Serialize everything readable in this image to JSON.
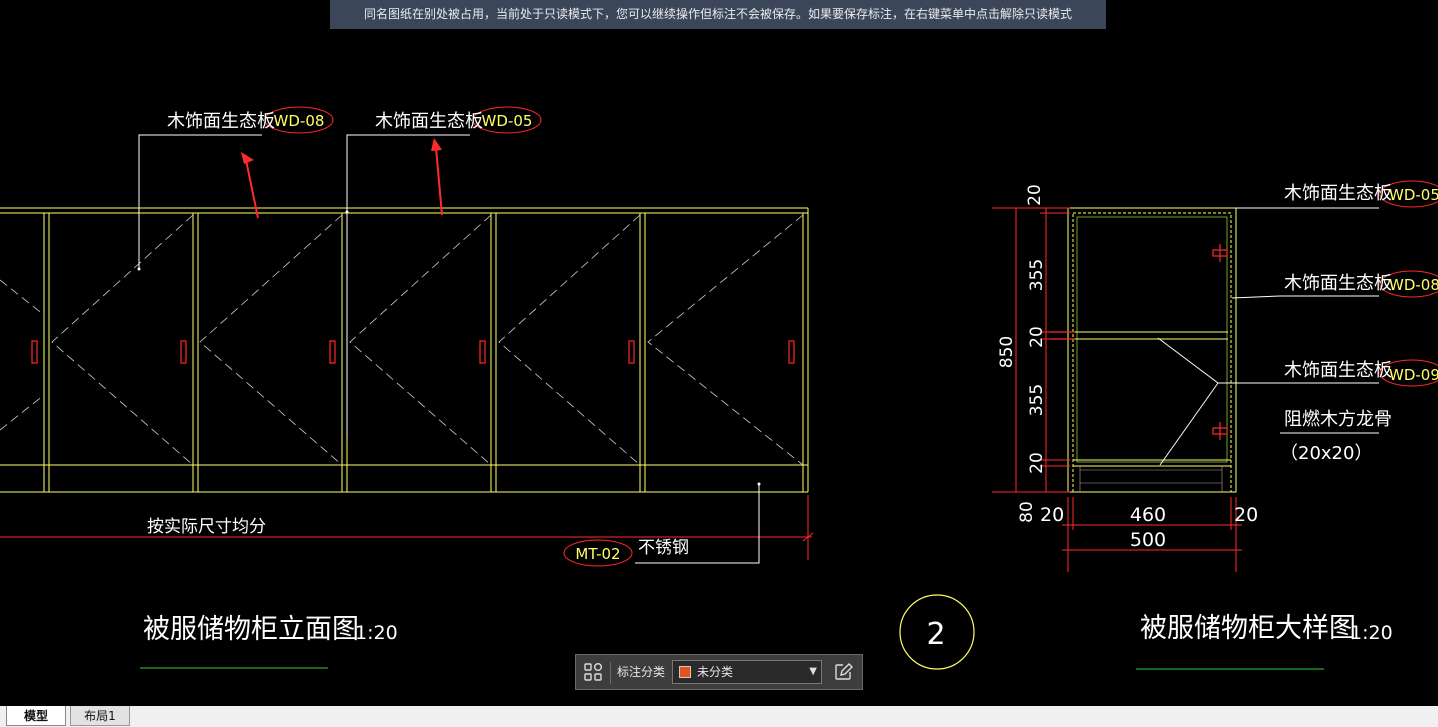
{
  "notice": "同名图纸在别处被占用，当前处于只读模式下，您可以继续操作但标注不会被保存。如果要保存标注，在右键菜单中点击解除只读模式",
  "elevation": {
    "label1": "木饰面生态板",
    "tag1": "WD-08",
    "label2": "木饰面生态板",
    "tag2": "WD-05",
    "dim_text": "按实际尺寸均分",
    "tag3": "MT-02",
    "label3": "不锈钢",
    "title": "被服储物柜立面图",
    "scale": "1:20"
  },
  "callout_number": "2",
  "detail": {
    "label1": "木饰面生态板",
    "tag1": "WD-05",
    "label2": "木饰面生态板",
    "tag2": "WD-08",
    "label3": "木饰面生态板",
    "tag3": "WD-09",
    "label4": "阻燃木方龙骨",
    "label4b": "（20x20）",
    "dims_v": [
      "20",
      "355",
      "20",
      "355",
      "20"
    ],
    "dim_total": "850",
    "dim_80": "80",
    "dims_h": [
      "20",
      "460",
      "20"
    ],
    "dim_500": "500",
    "title": "被服储物柜大样图",
    "scale": "1:20"
  },
  "annotation_bar": {
    "label": "标注分类",
    "selected": "未分类",
    "swatch_color": "#e8501e"
  },
  "tabs": {
    "model": "模型",
    "layout": "布局1"
  },
  "colors": {
    "background": "#000000",
    "cad_yellow": "#ffff66",
    "cad_red": "#ff0000",
    "cad_white": "#ffffff",
    "cad_green": "#33cc33"
  }
}
